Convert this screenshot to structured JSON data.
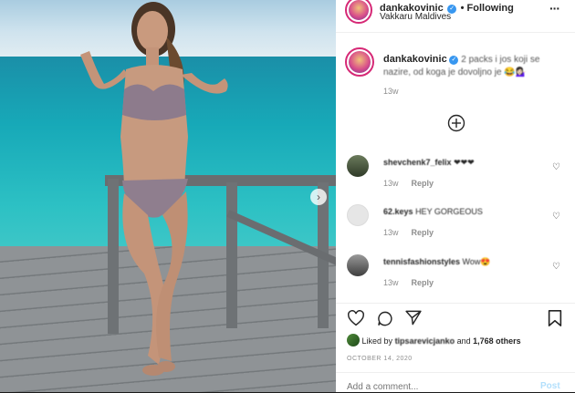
{
  "header": {
    "username": "dankakovinic",
    "follow_status": "• Following",
    "location": "Vakkaru Maldives",
    "more_icon": "more-dots-icon"
  },
  "caption": {
    "username": "dankakovinic",
    "text": "2 packs i jos koji se nazire, od koga je dovoljno je 😂💁🏻‍♀️",
    "age": "13w"
  },
  "load_more_icon": "plus-circle-icon",
  "comments": [
    {
      "username": "shevchenk7_felix",
      "text": "❤❤❤",
      "age": "13w",
      "reply": "Reply"
    },
    {
      "username": "62.keys",
      "text": "HEY GORGEOUS",
      "age": "13w",
      "reply": "Reply"
    },
    {
      "username": "tennisfashionstyles",
      "text": "Wow😍",
      "age": "13w",
      "reply": "Reply"
    }
  ],
  "likes": {
    "prefix": "Liked by",
    "user": "tipsarevicjanko",
    "joiner": "and",
    "count": "1,768 others"
  },
  "date": "OCTOBER 14, 2020",
  "add_comment": {
    "placeholder": "Add a comment...",
    "post_label": "Post"
  },
  "colors": {
    "accent": "#3897f0",
    "text": "#262626",
    "muted": "#8e8e8e"
  }
}
